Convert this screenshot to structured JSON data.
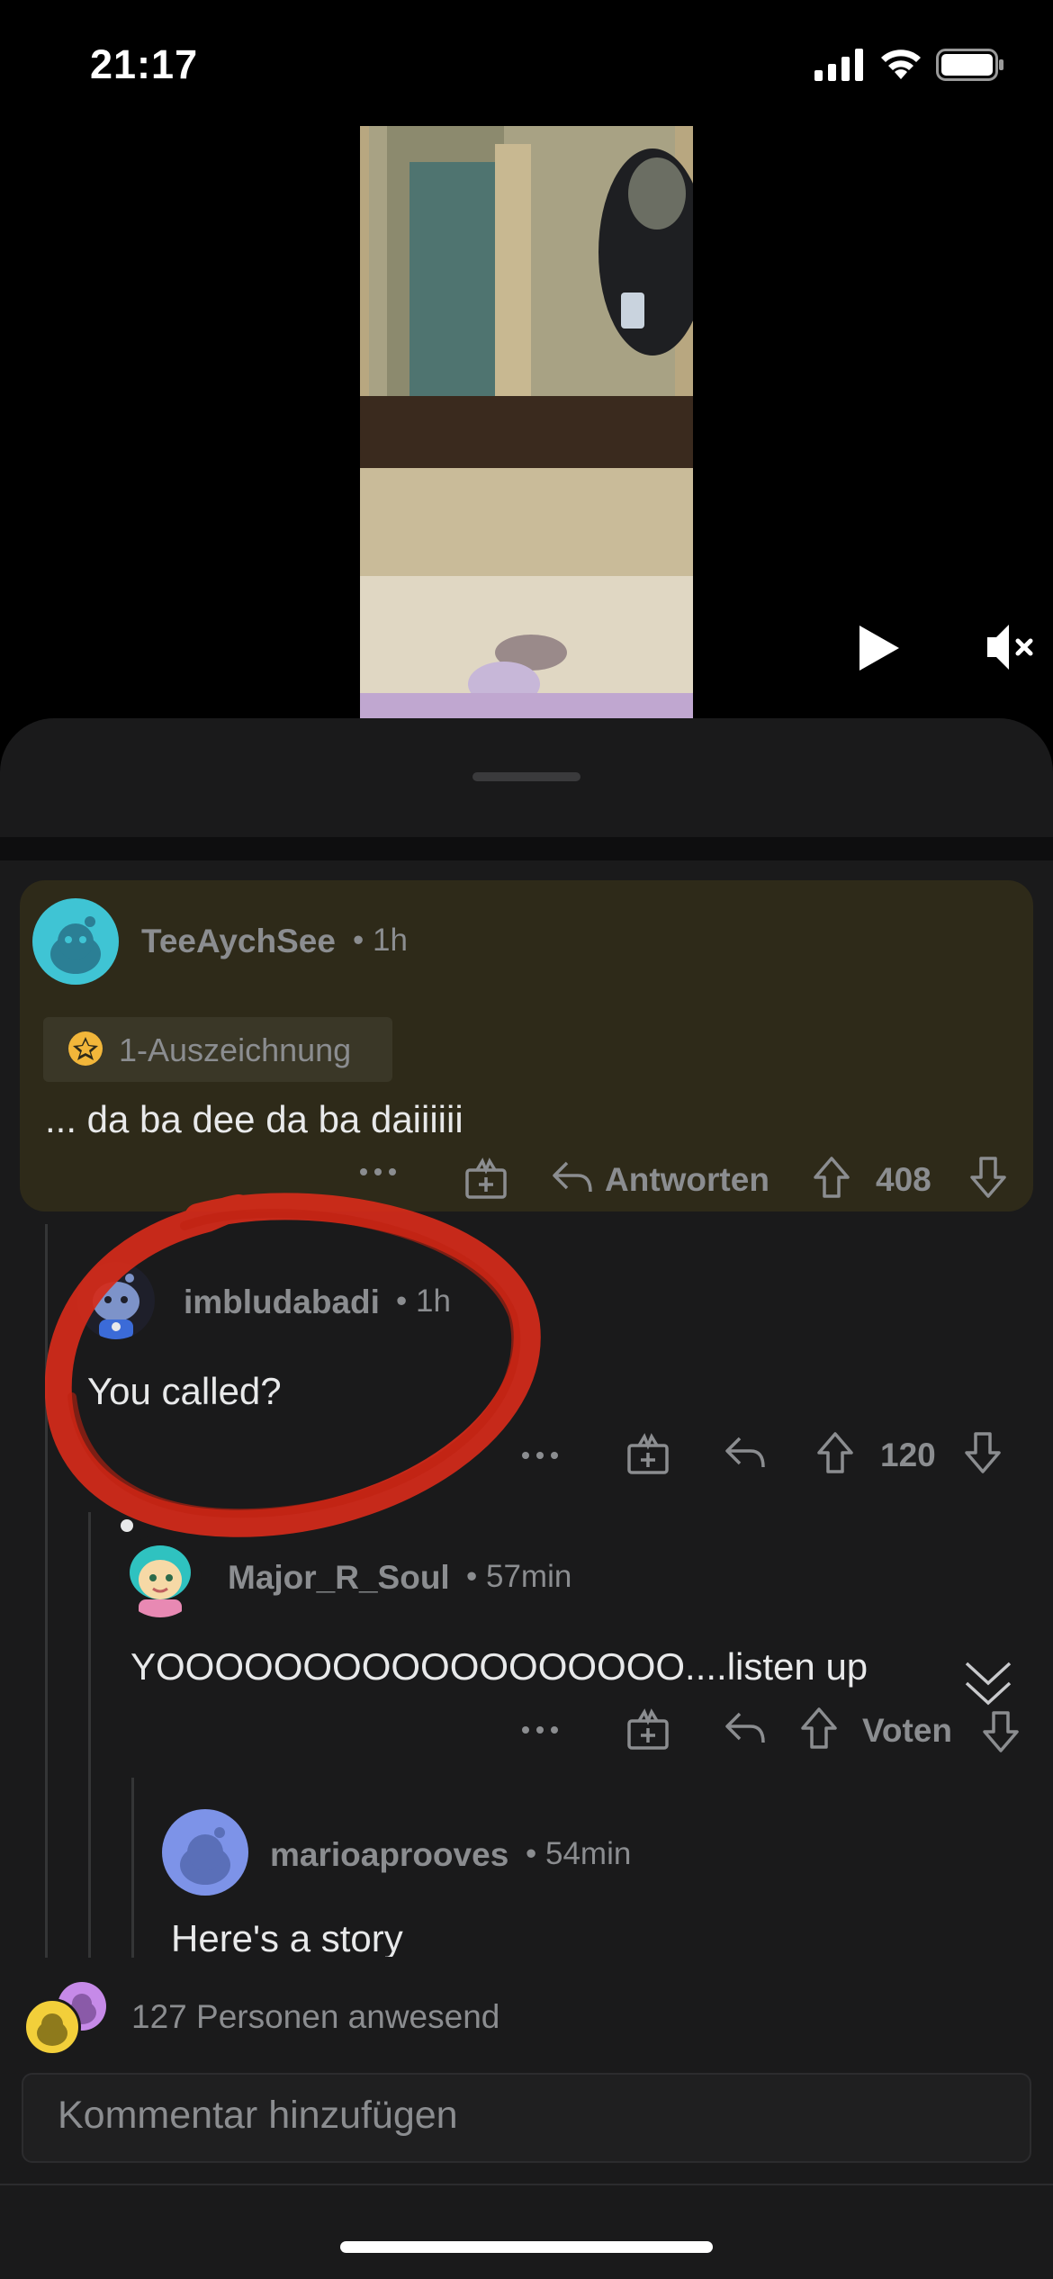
{
  "status_bar": {
    "time": "21:17"
  },
  "comments": [
    {
      "username": "TeeAychSee",
      "time": "1h",
      "award": "1-Auszeichnung",
      "body": "... da ba dee da ba daiiiiii",
      "reply_label": "Antworten",
      "votes": "408"
    },
    {
      "username": "imbludabadi",
      "time": "1h",
      "body": "You called?",
      "votes": "120"
    },
    {
      "username": "Major_R_Soul",
      "time": "57min",
      "body": "YOOOOOOOOOOOOOOOOOO....listen up",
      "votes": "Voten"
    },
    {
      "username": "marioaprooves",
      "time": "54min",
      "body": "Here's a story"
    }
  ],
  "presence": {
    "text": "127 Personen anwesend"
  },
  "comment_input": {
    "placeholder": "Kommentar hinzufügen"
  },
  "colors": {
    "sheet": "#1a1a1b",
    "highlight": "#2e2a19",
    "annotation": "#d42b1a"
  }
}
